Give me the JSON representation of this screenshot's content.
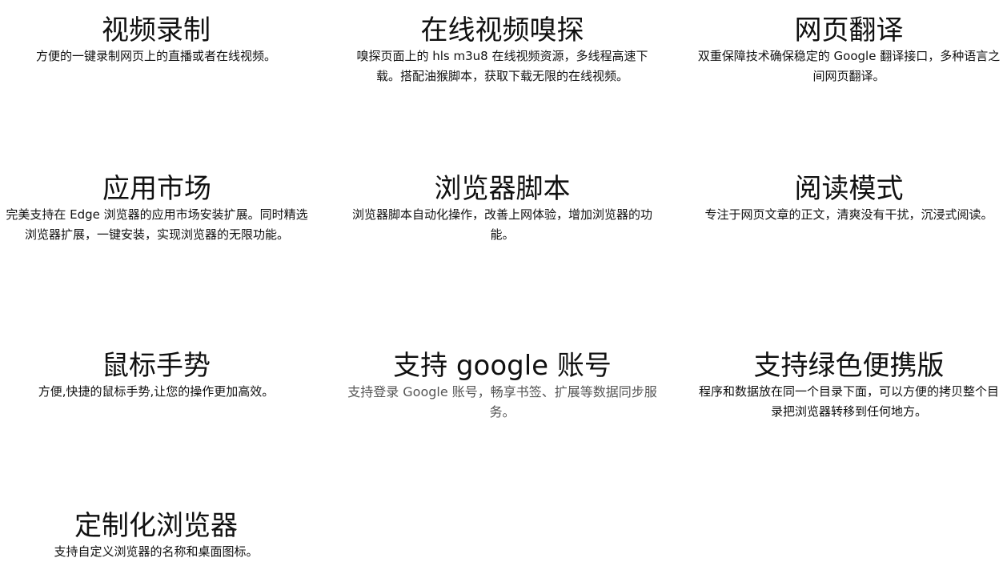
{
  "features": [
    {
      "title": "视频录制",
      "desc": "方便的一键录制网页上的直播或者在线视频。"
    },
    {
      "title": "在线视频嗅探",
      "desc": "嗅探页面上的 hls m3u8 在线视频资源，多线程高速下载。搭配油猴脚本，获取下载无限的在线视频。"
    },
    {
      "title": "网页翻译",
      "desc": "双重保障技术确保稳定的 Google 翻译接口，多种语言之间网页翻译。"
    },
    {
      "title": "应用市场",
      "desc": "完美支持在 Edge 浏览器的应用市场安装扩展。同时精选浏览器扩展，一键安装，实现浏览器的无限功能。"
    },
    {
      "title": "浏览器脚本",
      "desc": "浏览器脚本自动化操作，改善上网体验，增加浏览器的功能。"
    },
    {
      "title": "阅读模式",
      "desc": "专注于网页文章的正文，清爽没有干扰，沉浸式阅读。"
    },
    {
      "title": "鼠标手势",
      "desc": "方便,快捷的鼠标手势,让您的操作更加高效。"
    },
    {
      "title": "支持 google 账号",
      "desc": "支持登录 Google 账号，畅享书签、扩展等数据同步服务。"
    },
    {
      "title": "支持绿色便携版",
      "desc": "程序和数据放在同一个目录下面，可以方便的拷贝整个目录把浏览器转移到任何地方。"
    },
    {
      "title": "定制化浏览器",
      "desc": "支持自定义浏览器的名称和桌面图标。"
    }
  ]
}
